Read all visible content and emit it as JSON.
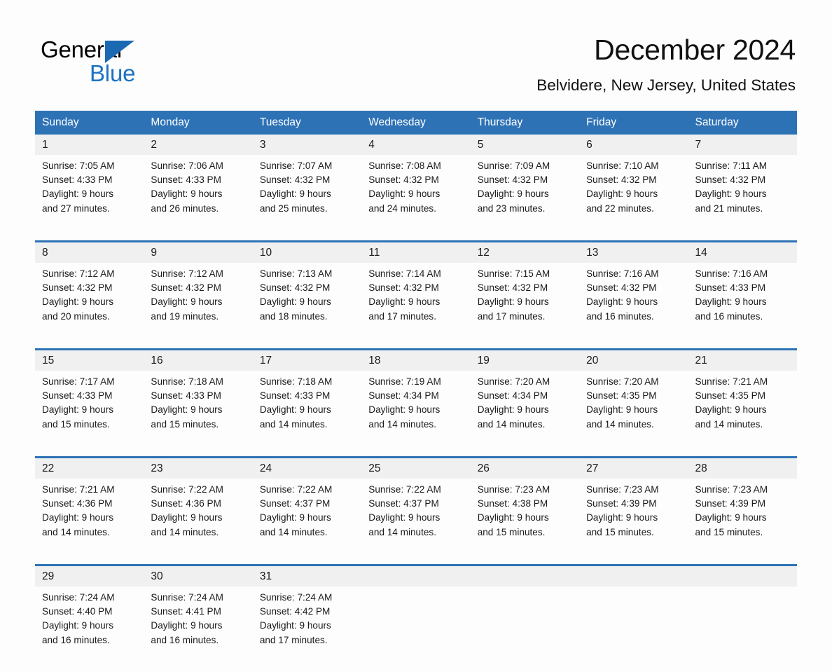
{
  "brand": {
    "name_part1": "General",
    "name_part2": "Blue",
    "triangle_color": "#1b69b2",
    "blue_text_color": "#1b72c4"
  },
  "header": {
    "title": "December 2024",
    "location": "Belvidere, New Jersey, United States"
  },
  "theme": {
    "header_blue": "#2e72b6",
    "date_band_gray": "#f0f0f0",
    "page_background": "#fdfdfd",
    "text_color": "#1a1a1a"
  },
  "calendar": {
    "weekday_headers": [
      "Sunday",
      "Monday",
      "Tuesday",
      "Wednesday",
      "Thursday",
      "Friday",
      "Saturday"
    ],
    "weeks": [
      [
        {
          "day": "1",
          "sunrise": "Sunrise: 7:05 AM",
          "sunset": "Sunset: 4:33 PM",
          "daylight_line1": "Daylight: 9 hours",
          "daylight_line2": "and 27 minutes."
        },
        {
          "day": "2",
          "sunrise": "Sunrise: 7:06 AM",
          "sunset": "Sunset: 4:33 PM",
          "daylight_line1": "Daylight: 9 hours",
          "daylight_line2": "and 26 minutes."
        },
        {
          "day": "3",
          "sunrise": "Sunrise: 7:07 AM",
          "sunset": "Sunset: 4:32 PM",
          "daylight_line1": "Daylight: 9 hours",
          "daylight_line2": "and 25 minutes."
        },
        {
          "day": "4",
          "sunrise": "Sunrise: 7:08 AM",
          "sunset": "Sunset: 4:32 PM",
          "daylight_line1": "Daylight: 9 hours",
          "daylight_line2": "and 24 minutes."
        },
        {
          "day": "5",
          "sunrise": "Sunrise: 7:09 AM",
          "sunset": "Sunset: 4:32 PM",
          "daylight_line1": "Daylight: 9 hours",
          "daylight_line2": "and 23 minutes."
        },
        {
          "day": "6",
          "sunrise": "Sunrise: 7:10 AM",
          "sunset": "Sunset: 4:32 PM",
          "daylight_line1": "Daylight: 9 hours",
          "daylight_line2": "and 22 minutes."
        },
        {
          "day": "7",
          "sunrise": "Sunrise: 7:11 AM",
          "sunset": "Sunset: 4:32 PM",
          "daylight_line1": "Daylight: 9 hours",
          "daylight_line2": "and 21 minutes."
        }
      ],
      [
        {
          "day": "8",
          "sunrise": "Sunrise: 7:12 AM",
          "sunset": "Sunset: 4:32 PM",
          "daylight_line1": "Daylight: 9 hours",
          "daylight_line2": "and 20 minutes."
        },
        {
          "day": "9",
          "sunrise": "Sunrise: 7:12 AM",
          "sunset": "Sunset: 4:32 PM",
          "daylight_line1": "Daylight: 9 hours",
          "daylight_line2": "and 19 minutes."
        },
        {
          "day": "10",
          "sunrise": "Sunrise: 7:13 AM",
          "sunset": "Sunset: 4:32 PM",
          "daylight_line1": "Daylight: 9 hours",
          "daylight_line2": "and 18 minutes."
        },
        {
          "day": "11",
          "sunrise": "Sunrise: 7:14 AM",
          "sunset": "Sunset: 4:32 PM",
          "daylight_line1": "Daylight: 9 hours",
          "daylight_line2": "and 17 minutes."
        },
        {
          "day": "12",
          "sunrise": "Sunrise: 7:15 AM",
          "sunset": "Sunset: 4:32 PM",
          "daylight_line1": "Daylight: 9 hours",
          "daylight_line2": "and 17 minutes."
        },
        {
          "day": "13",
          "sunrise": "Sunrise: 7:16 AM",
          "sunset": "Sunset: 4:32 PM",
          "daylight_line1": "Daylight: 9 hours",
          "daylight_line2": "and 16 minutes."
        },
        {
          "day": "14",
          "sunrise": "Sunrise: 7:16 AM",
          "sunset": "Sunset: 4:33 PM",
          "daylight_line1": "Daylight: 9 hours",
          "daylight_line2": "and 16 minutes."
        }
      ],
      [
        {
          "day": "15",
          "sunrise": "Sunrise: 7:17 AM",
          "sunset": "Sunset: 4:33 PM",
          "daylight_line1": "Daylight: 9 hours",
          "daylight_line2": "and 15 minutes."
        },
        {
          "day": "16",
          "sunrise": "Sunrise: 7:18 AM",
          "sunset": "Sunset: 4:33 PM",
          "daylight_line1": "Daylight: 9 hours",
          "daylight_line2": "and 15 minutes."
        },
        {
          "day": "17",
          "sunrise": "Sunrise: 7:18 AM",
          "sunset": "Sunset: 4:33 PM",
          "daylight_line1": "Daylight: 9 hours",
          "daylight_line2": "and 14 minutes."
        },
        {
          "day": "18",
          "sunrise": "Sunrise: 7:19 AM",
          "sunset": "Sunset: 4:34 PM",
          "daylight_line1": "Daylight: 9 hours",
          "daylight_line2": "and 14 minutes."
        },
        {
          "day": "19",
          "sunrise": "Sunrise: 7:20 AM",
          "sunset": "Sunset: 4:34 PM",
          "daylight_line1": "Daylight: 9 hours",
          "daylight_line2": "and 14 minutes."
        },
        {
          "day": "20",
          "sunrise": "Sunrise: 7:20 AM",
          "sunset": "Sunset: 4:35 PM",
          "daylight_line1": "Daylight: 9 hours",
          "daylight_line2": "and 14 minutes."
        },
        {
          "day": "21",
          "sunrise": "Sunrise: 7:21 AM",
          "sunset": "Sunset: 4:35 PM",
          "daylight_line1": "Daylight: 9 hours",
          "daylight_line2": "and 14 minutes."
        }
      ],
      [
        {
          "day": "22",
          "sunrise": "Sunrise: 7:21 AM",
          "sunset": "Sunset: 4:36 PM",
          "daylight_line1": "Daylight: 9 hours",
          "daylight_line2": "and 14 minutes."
        },
        {
          "day": "23",
          "sunrise": "Sunrise: 7:22 AM",
          "sunset": "Sunset: 4:36 PM",
          "daylight_line1": "Daylight: 9 hours",
          "daylight_line2": "and 14 minutes."
        },
        {
          "day": "24",
          "sunrise": "Sunrise: 7:22 AM",
          "sunset": "Sunset: 4:37 PM",
          "daylight_line1": "Daylight: 9 hours",
          "daylight_line2": "and 14 minutes."
        },
        {
          "day": "25",
          "sunrise": "Sunrise: 7:22 AM",
          "sunset": "Sunset: 4:37 PM",
          "daylight_line1": "Daylight: 9 hours",
          "daylight_line2": "and 14 minutes."
        },
        {
          "day": "26",
          "sunrise": "Sunrise: 7:23 AM",
          "sunset": "Sunset: 4:38 PM",
          "daylight_line1": "Daylight: 9 hours",
          "daylight_line2": "and 15 minutes."
        },
        {
          "day": "27",
          "sunrise": "Sunrise: 7:23 AM",
          "sunset": "Sunset: 4:39 PM",
          "daylight_line1": "Daylight: 9 hours",
          "daylight_line2": "and 15 minutes."
        },
        {
          "day": "28",
          "sunrise": "Sunrise: 7:23 AM",
          "sunset": "Sunset: 4:39 PM",
          "daylight_line1": "Daylight: 9 hours",
          "daylight_line2": "and 15 minutes."
        }
      ],
      [
        {
          "day": "29",
          "sunrise": "Sunrise: 7:24 AM",
          "sunset": "Sunset: 4:40 PM",
          "daylight_line1": "Daylight: 9 hours",
          "daylight_line2": "and 16 minutes."
        },
        {
          "day": "30",
          "sunrise": "Sunrise: 7:24 AM",
          "sunset": "Sunset: 4:41 PM",
          "daylight_line1": "Daylight: 9 hours",
          "daylight_line2": "and 16 minutes."
        },
        {
          "day": "31",
          "sunrise": "Sunrise: 7:24 AM",
          "sunset": "Sunset: 4:42 PM",
          "daylight_line1": "Daylight: 9 hours",
          "daylight_line2": "and 17 minutes."
        },
        {
          "day": "",
          "sunrise": "",
          "sunset": "",
          "daylight_line1": "",
          "daylight_line2": ""
        },
        {
          "day": "",
          "sunrise": "",
          "sunset": "",
          "daylight_line1": "",
          "daylight_line2": ""
        },
        {
          "day": "",
          "sunrise": "",
          "sunset": "",
          "daylight_line1": "",
          "daylight_line2": ""
        },
        {
          "day": "",
          "sunrise": "",
          "sunset": "",
          "daylight_line1": "",
          "daylight_line2": ""
        }
      ]
    ]
  }
}
